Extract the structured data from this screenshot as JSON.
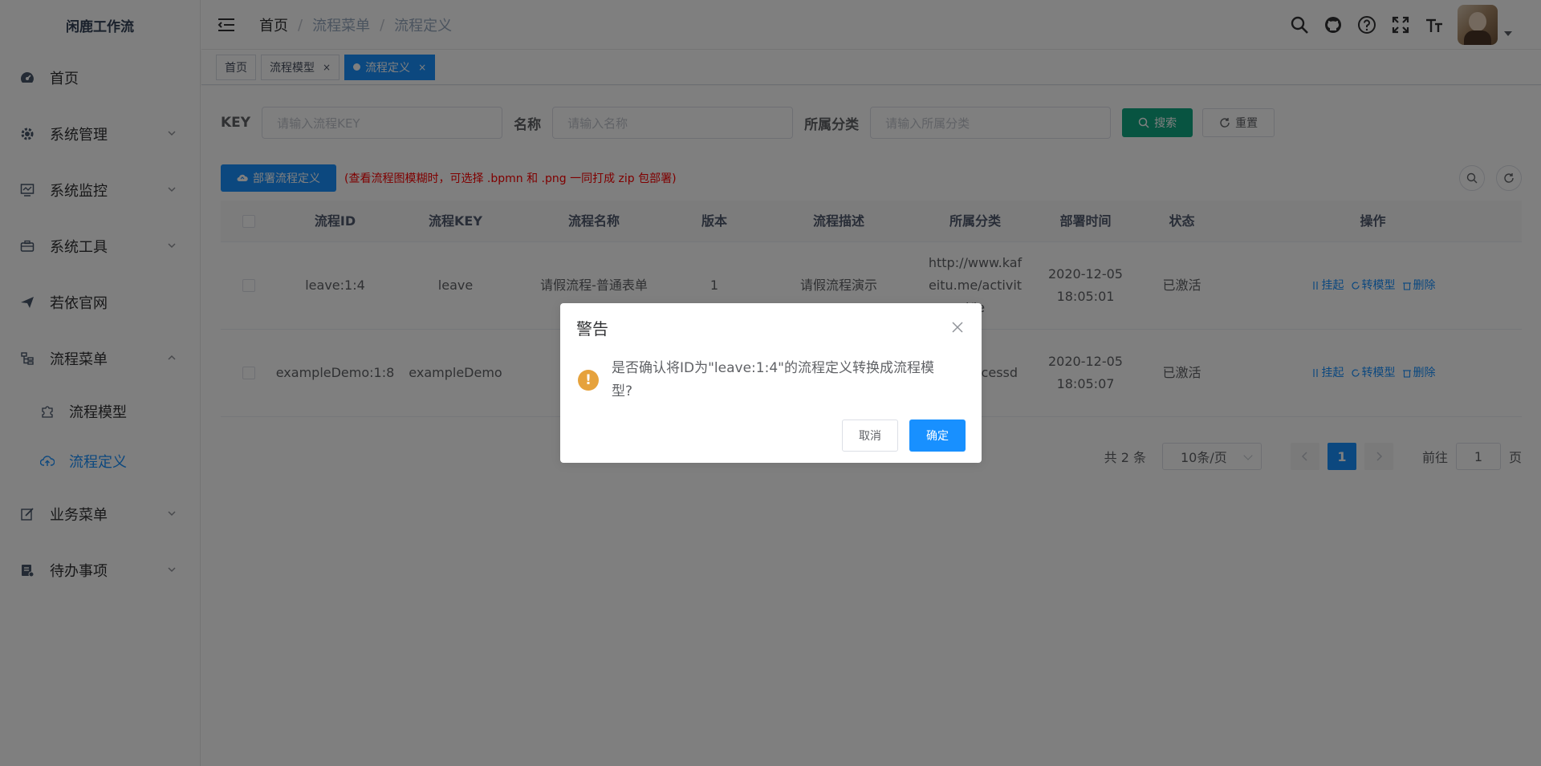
{
  "app": {
    "logo_text": "闲鹿工作流"
  },
  "sidebar": {
    "items": [
      {
        "label": "首页",
        "icon": "dashboard-icon"
      },
      {
        "label": "系统管理",
        "icon": "system-icon"
      },
      {
        "label": "系统监控",
        "icon": "monitor-icon"
      },
      {
        "label": "系统工具",
        "icon": "tool-icon"
      },
      {
        "label": "若依官网",
        "icon": "guide-icon"
      },
      {
        "label": "流程菜单",
        "icon": "tree-icon"
      },
      {
        "label": "流程模型",
        "icon": "puzzle-icon"
      },
      {
        "label": "流程定义",
        "icon": "cloud-upload-icon"
      },
      {
        "label": "业务菜单",
        "icon": "edit-icon"
      },
      {
        "label": "待办事项",
        "icon": "todo-icon"
      }
    ]
  },
  "navbar": {
    "breadcrumb": [
      "首页",
      "流程菜单",
      "流程定义"
    ],
    "separator": "/"
  },
  "tags": [
    {
      "label": "首页"
    },
    {
      "label": "流程模型",
      "close": "×"
    },
    {
      "label": "流程定义",
      "close": "×"
    }
  ],
  "search": {
    "key_label": "KEY",
    "key_placeholder": "请输入流程KEY",
    "name_label": "名称",
    "name_placeholder": "请输入名称",
    "category_label": "所属分类",
    "category_placeholder": "请输入所属分类",
    "search_button": "搜索",
    "reset_button": "重置"
  },
  "toolbar": {
    "deploy_button": "部署流程定义",
    "hint": "(查看流程图模糊时，可选择 .bpmn 和 .png 一同打成 zip 包部署)"
  },
  "table": {
    "headers": [
      "流程ID",
      "流程KEY",
      "流程名称",
      "版本",
      "流程描述",
      "所属分类",
      "部署时间",
      "状态",
      "操作"
    ],
    "rows": [
      {
        "id": "leave:1:4",
        "key": "leave",
        "name": "请假流程-普通表单",
        "version": "1",
        "desc": "请假流程演示",
        "category": "http://www.kafeitu.me/activiti/le",
        "time": "2020-12-05 18:05:01",
        "status": "已激活"
      },
      {
        "id": "exampleDemo:1:8",
        "key": "exampleDemo",
        "name": "",
        "version": "",
        "desc": "",
        "category": "w.activ cessd",
        "time": "2020-12-05 18:05:07",
        "status": "已激活"
      }
    ],
    "ops": {
      "suspend": "挂起",
      "convert": "转模型",
      "delete": "删除"
    }
  },
  "pagination": {
    "total": "共 2 条",
    "page_size": "10条/页",
    "current": "1",
    "goto_label": "前往",
    "goto_value": "1",
    "page_suffix": "页"
  },
  "dialog": {
    "title": "警告",
    "message": "是否确认将ID为\"leave:1:4\"的流程定义转换成流程模型?",
    "cancel": "取消",
    "confirm": "确定",
    "warn_glyph": "!"
  },
  "colors": {
    "primary": "#1890ff",
    "search": "#11a983",
    "warning": "#e6a23c",
    "hint": "#ff0000"
  }
}
